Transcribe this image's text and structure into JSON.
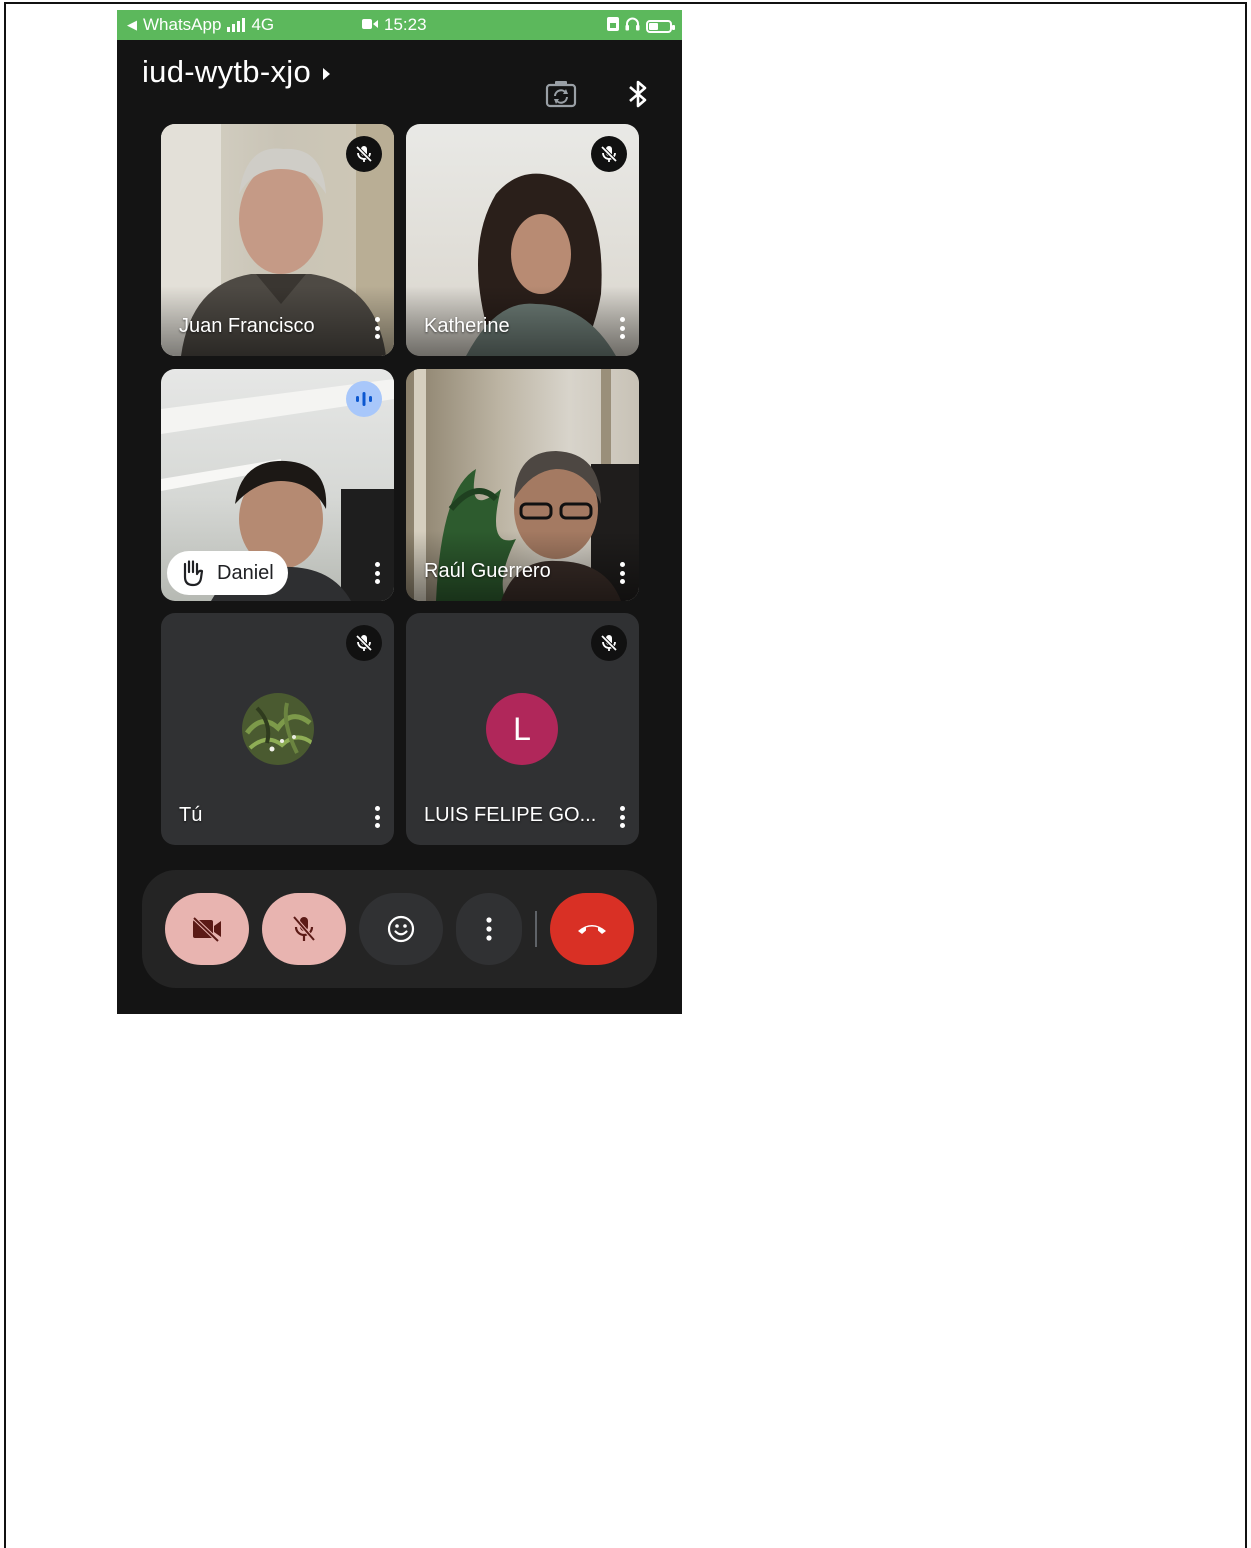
{
  "status_bar": {
    "back_app": "WhatsApp",
    "network": "4G",
    "time": "15:23"
  },
  "meeting": {
    "code": "iud-wytb-xjo"
  },
  "participants": [
    {
      "name": "Juan Francisco",
      "muted": true
    },
    {
      "name": "Katherine",
      "muted": true
    },
    {
      "name": "Daniel",
      "muted": false,
      "speaking": true,
      "hand_raised": true
    },
    {
      "name": "Raúl Guerrero",
      "muted": false
    },
    {
      "name": "Tú",
      "muted": true
    },
    {
      "name": "LUIS FELIPE GO...",
      "muted": true,
      "avatar_letter": "L"
    }
  ],
  "controls": {
    "camera": "camera-off-icon",
    "mic": "mic-off-icon",
    "reactions": "emoji-icon",
    "more": "more-vert-icon",
    "leave": "call-end-icon"
  },
  "colors": {
    "status_bar": "#5cb85c",
    "background": "#141414",
    "tile": "#303133",
    "toggle_off": "#e8b4b0",
    "end_call": "#d93025",
    "avatar_L": "#b0275a",
    "speaking": "#a8c7fa"
  }
}
